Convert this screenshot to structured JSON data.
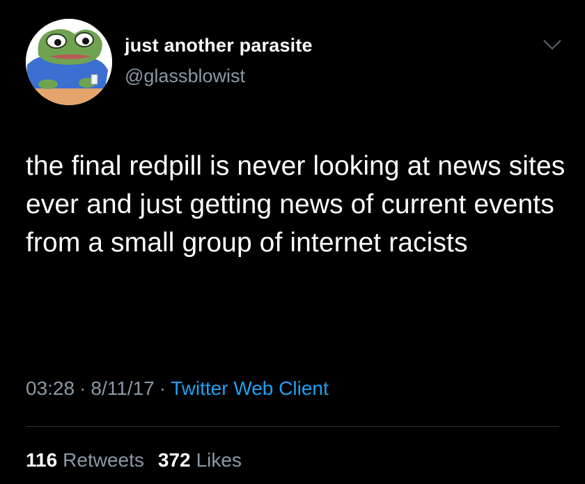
{
  "tweet": {
    "author": {
      "display_name": "just another parasite",
      "handle": "@glassblowist",
      "avatar_icon": "frog-avatar-icon"
    },
    "text": "the final redpill is never looking at news sites ever and just getting news of current events from a small group of internet racists",
    "meta": {
      "time": "03:28",
      "separator": "·",
      "date": "8/11/17",
      "source": "Twitter Web Client"
    },
    "stats": {
      "retweets_count": "116",
      "retweets_label": "Retweets",
      "likes_count": "372",
      "likes_label": "Likes"
    }
  },
  "colors": {
    "background": "#000000",
    "primary_text": "#ffffff",
    "secondary_text": "#8b98a5",
    "link": "#1da1f2",
    "divider": "#2f3336"
  }
}
